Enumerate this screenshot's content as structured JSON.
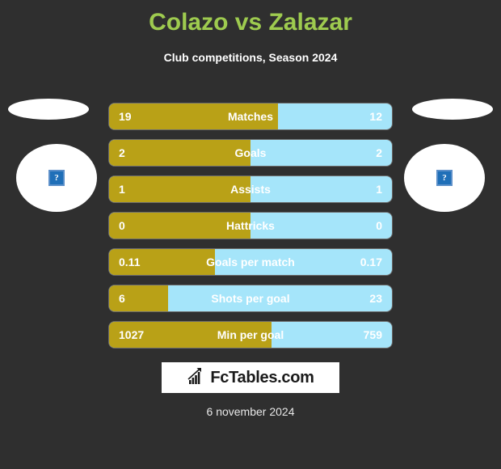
{
  "header": {
    "title": "Colazo vs Zalazar",
    "subtitle": "Club competitions, Season 2024",
    "title_color": "#9ecb4f"
  },
  "players": {
    "left": {
      "icon": "broken-image-placeholder",
      "placeholder_glyph": "?"
    },
    "right": {
      "icon": "broken-image-placeholder",
      "placeholder_glyph": "?"
    }
  },
  "colors": {
    "home": "#b9a117",
    "away": "#a5e5fa",
    "background": "#2f2f2f",
    "text": "#ffffff"
  },
  "chart_data": {
    "type": "bar",
    "title": "Colazo vs Zalazar",
    "subtitle": "Club competitions, Season 2024",
    "orientation": "horizontal-diverging",
    "series": [
      {
        "name": "Colazo",
        "color": "#b9a117",
        "values": [
          19,
          2,
          1,
          0,
          0.11,
          6,
          1027
        ]
      },
      {
        "name": "Zalazar",
        "color": "#a5e5fa",
        "values": [
          12,
          2,
          1,
          0,
          0.17,
          23,
          759
        ]
      }
    ],
    "categories": [
      "Matches",
      "Goals",
      "Assists",
      "Hattricks",
      "Goals per match",
      "Shots per goal",
      "Min per goal"
    ],
    "grid": false,
    "legend": "none"
  },
  "rows": [
    {
      "label": "Matches",
      "left": "19",
      "right": "12",
      "fill_pct": 59.7
    },
    {
      "label": "Goals",
      "left": "2",
      "right": "2",
      "fill_pct": 50.0
    },
    {
      "label": "Assists",
      "left": "1",
      "right": "1",
      "fill_pct": 50.0
    },
    {
      "label": "Hattricks",
      "left": "0",
      "right": "0",
      "fill_pct": 50.0
    },
    {
      "label": "Goals per match",
      "left": "0.11",
      "right": "0.17",
      "fill_pct": 37.4
    },
    {
      "label": "Shots per goal",
      "left": "6",
      "right": "23",
      "fill_pct": 20.9
    },
    {
      "label": "Min per goal",
      "left": "1027",
      "right": "759",
      "fill_pct": 57.4
    }
  ],
  "footer": {
    "logo_text": "FcTables.com",
    "logo_icon": "bar-chart-trend-icon",
    "date": "6 november 2024"
  }
}
